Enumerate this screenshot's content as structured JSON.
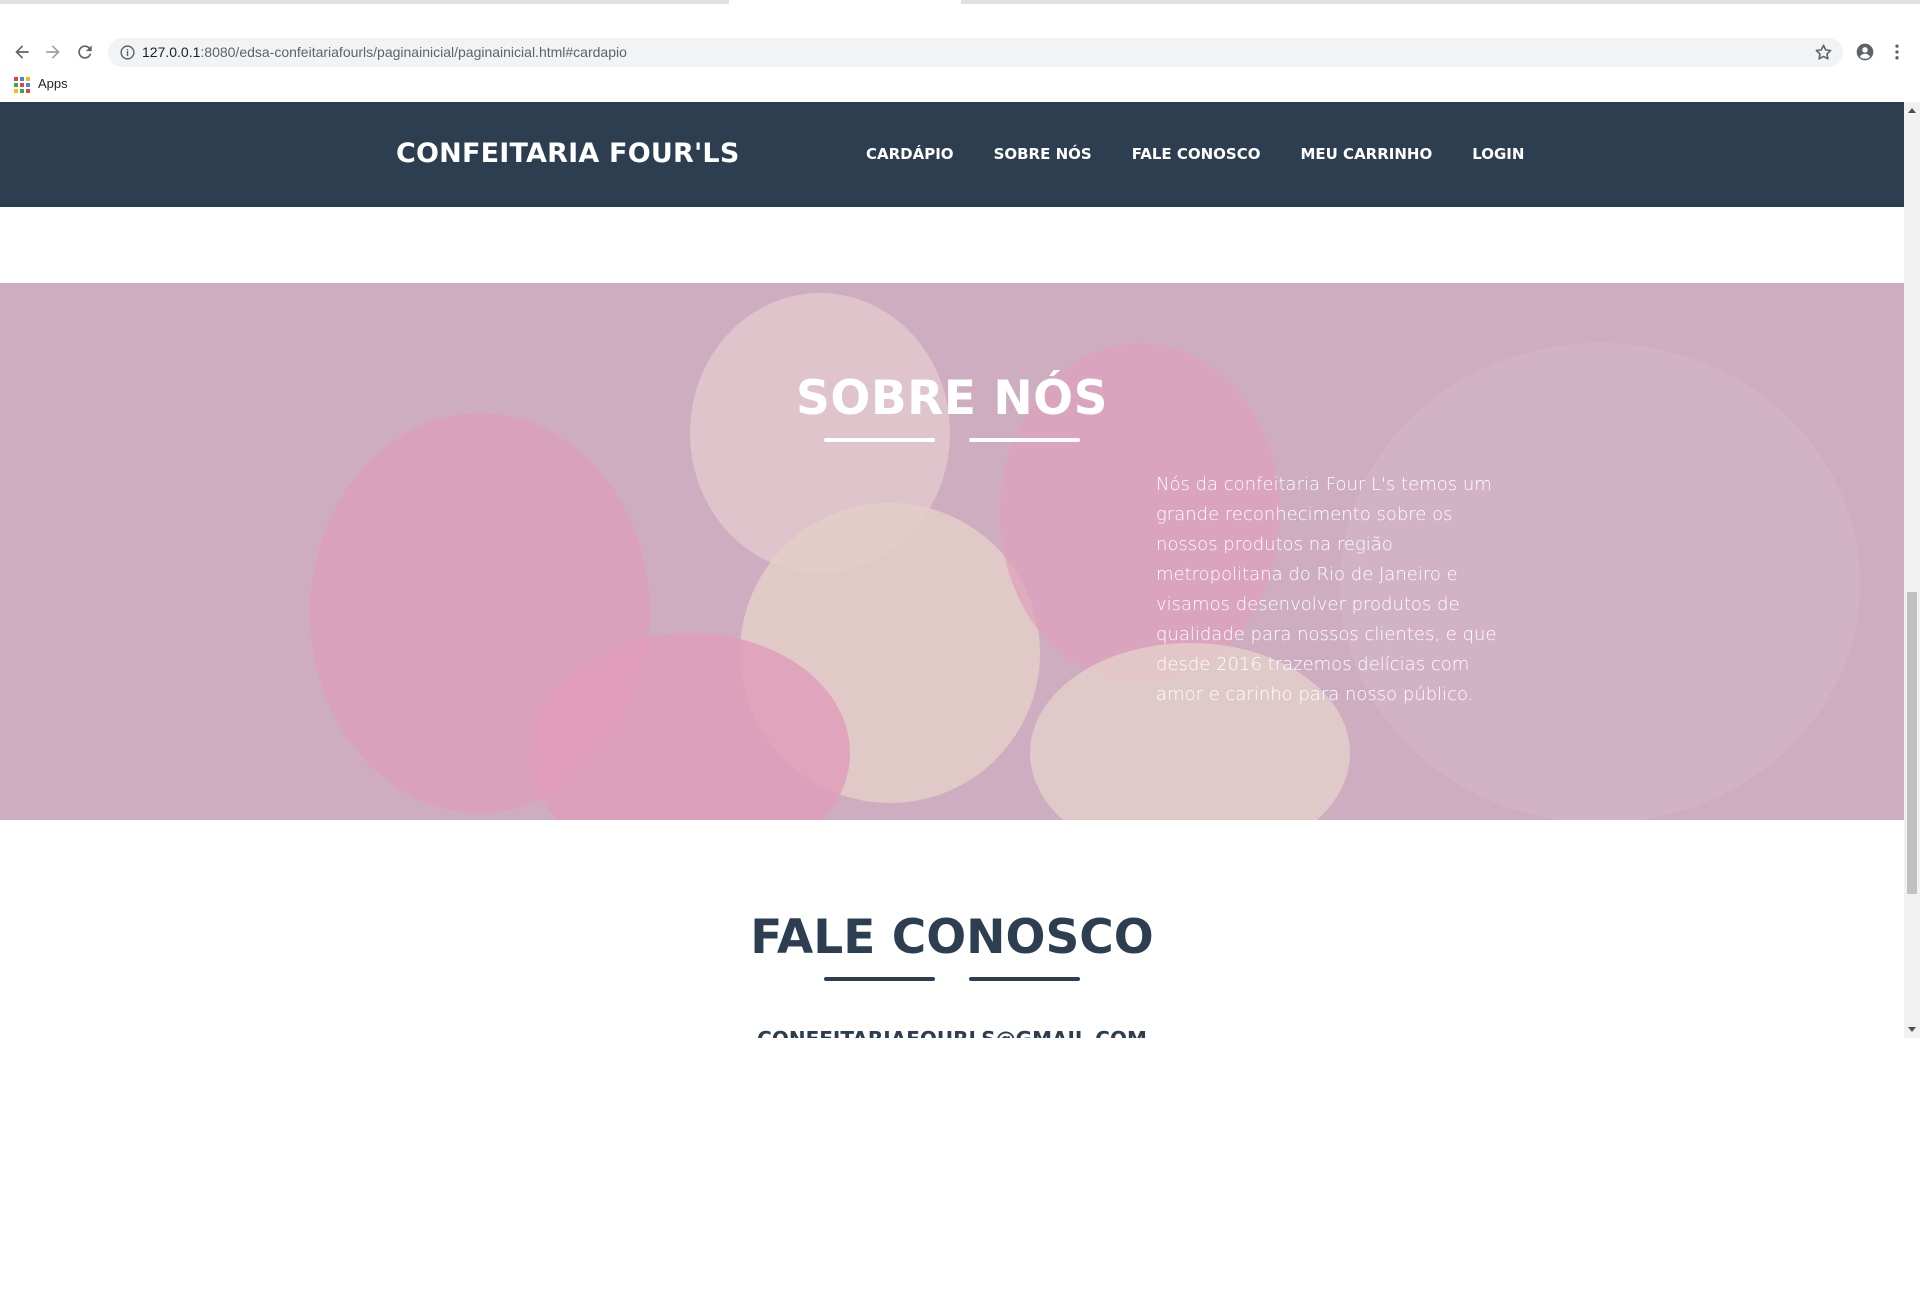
{
  "browser": {
    "url_host": "127.0.0.1",
    "url_path": ":8080/edsa-confeitariafourls/paginainicial/paginainicial.html#cardapio",
    "bookmarks": {
      "apps_label": "Apps"
    }
  },
  "site": {
    "brand": "CONFEITARIA FOUR'LS",
    "nav": [
      "CARDÁPIO",
      "SOBRE NÓS",
      "FALE CONOSCO",
      "MEU CARRINHO",
      "LOGIN"
    ],
    "about": {
      "title": "SOBRE NÓS",
      "text": "Nós da confeitaria Four L's temos um grande reconhecimento sobre os nossos produtos na região metropolitana do Rio de Janeiro e visamos desenvolver produtos de qualidade para nossos clientes, e que desde 2016 trazemos delícias com amor e carinho para nosso público."
    },
    "contact": {
      "title": "FALE CONOSCO",
      "email": "CONFEITARIAFOURLS@GMAIL.COM"
    }
  },
  "colors": {
    "header_bg": "#2c3e50",
    "accent_text": "#2c3e50",
    "about_overlay": "#d8bbcc"
  },
  "icons": [
    "back-arrow-icon",
    "forward-arrow-icon",
    "reload-icon",
    "info-icon",
    "star-icon",
    "account-icon",
    "menu-dots-icon",
    "apps-grid-icon"
  ]
}
